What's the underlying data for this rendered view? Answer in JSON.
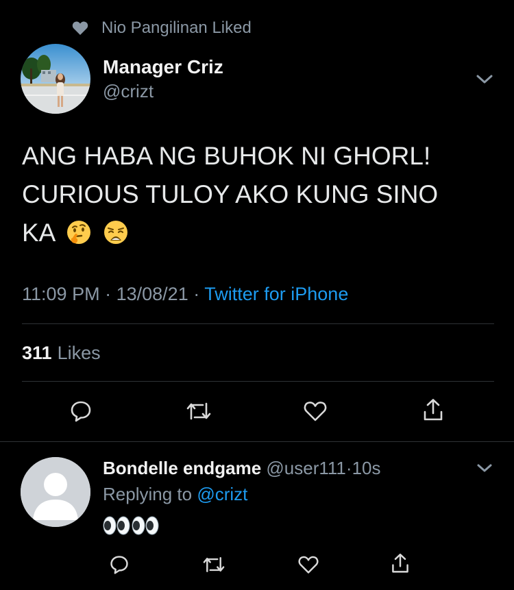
{
  "social_context": {
    "text": "Nio Pangilinan Liked",
    "icon": "heart-icon"
  },
  "tweet": {
    "author_name": "Manager Criz",
    "author_handle": "@crizt",
    "text_line1": "ANG HABA NG BUHOK NI GHORL!",
    "text_line2": "CURIOUS TULOY AKO KUNG SINO",
    "text_line3": "KA",
    "emojis": [
      "thinking-face-emoji",
      "weary-face-emoji"
    ],
    "time": "11:09 PM",
    "date": "13/08/21",
    "separator": "·",
    "source": "Twitter for iPhone",
    "likes_count": "311",
    "likes_label": "Likes",
    "actions": [
      "reply-icon",
      "retweet-icon",
      "like-icon",
      "share-icon"
    ]
  },
  "reply": {
    "author_name": "Bondelle endgame",
    "author_handle": "@user111",
    "separator": "·",
    "time": "10s",
    "replying_prefix": "Replying to",
    "replying_to": "@crizt",
    "content": [
      "eyes-emoji",
      "eyes-emoji"
    ]
  },
  "colors": {
    "background": "#000000",
    "secondary_text": "#8b98a5",
    "link": "#1d9bf0",
    "divider": "#2f3336"
  }
}
